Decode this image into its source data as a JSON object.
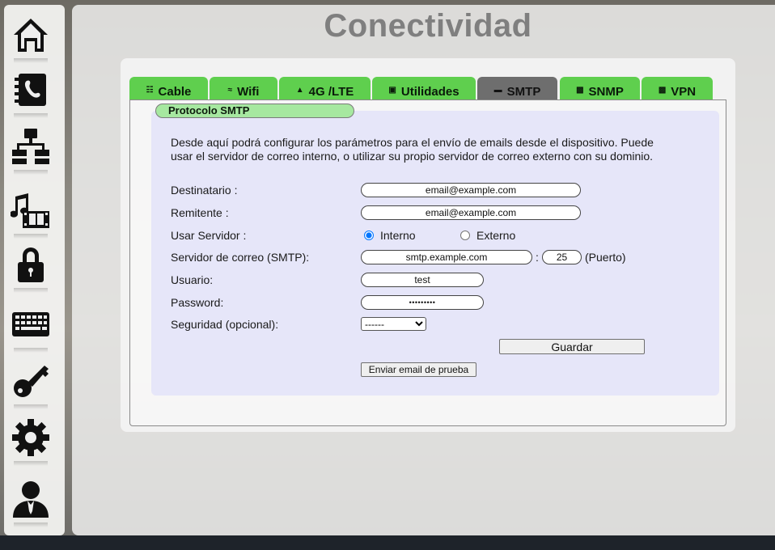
{
  "sidebar": {
    "items": [
      {
        "icon": "home-icon"
      },
      {
        "icon": "phonebook-icon"
      },
      {
        "icon": "network-icon"
      },
      {
        "icon": "multimedia-icon"
      },
      {
        "icon": "lock-icon"
      },
      {
        "icon": "keyboard-icon"
      },
      {
        "icon": "key-icon"
      },
      {
        "icon": "gear-icon"
      },
      {
        "icon": "user-icon"
      }
    ]
  },
  "page": {
    "title": "Conectividad"
  },
  "tabs": [
    {
      "label": "Cable",
      "icon": "ethernet-icon"
    },
    {
      "label": "Wifi",
      "icon": "wifi-icon"
    },
    {
      "label": "4G /LTE",
      "icon": "antenna-icon"
    },
    {
      "label": "Utilidades",
      "icon": "tools-icon"
    },
    {
      "label": "SMTP",
      "icon": "mail-icon",
      "active": true
    },
    {
      "label": "SNMP",
      "icon": "document-icon"
    },
    {
      "label": "VPN",
      "icon": "document-icon"
    }
  ],
  "smtp": {
    "section_title": "Protocolo SMTP",
    "description": "Desde aquí podrá configurar los parámetros para el envío de emails desde el dispositivo. Puede usar el servidor de correo interno, o utilizar su propio servidor de correo externo con su dominio.",
    "recipient_label": "Destinatario :",
    "recipient_value": "email@example.com",
    "sender_label": "Remitente :",
    "sender_value": "email@example.com",
    "server_choice_label": "Usar Servidor :",
    "server_internal": "Interno",
    "server_external": "Externo",
    "server_selected": "Interno",
    "smtp_server_label": "Servidor de correo (SMTP):",
    "smtp_server_value": "smtp.example.com",
    "port_separator": ":",
    "port_value": "25",
    "port_label": "(Puerto)",
    "user_label": "Usuario:",
    "user_value": "test",
    "password_label": "Password:",
    "password_value": "•••••••••",
    "security_label": "Seguridad (opcional):",
    "security_selected": "------",
    "save_button": "Guardar",
    "test_email_button": "Enviar email de prueba"
  },
  "colors": {
    "tab": "#5fcf4e",
    "tab_active": "#6e6e6e",
    "section_label": "#a6e8a0",
    "inner_panel": "#dcdcfa",
    "title": "#7f7f7f"
  }
}
